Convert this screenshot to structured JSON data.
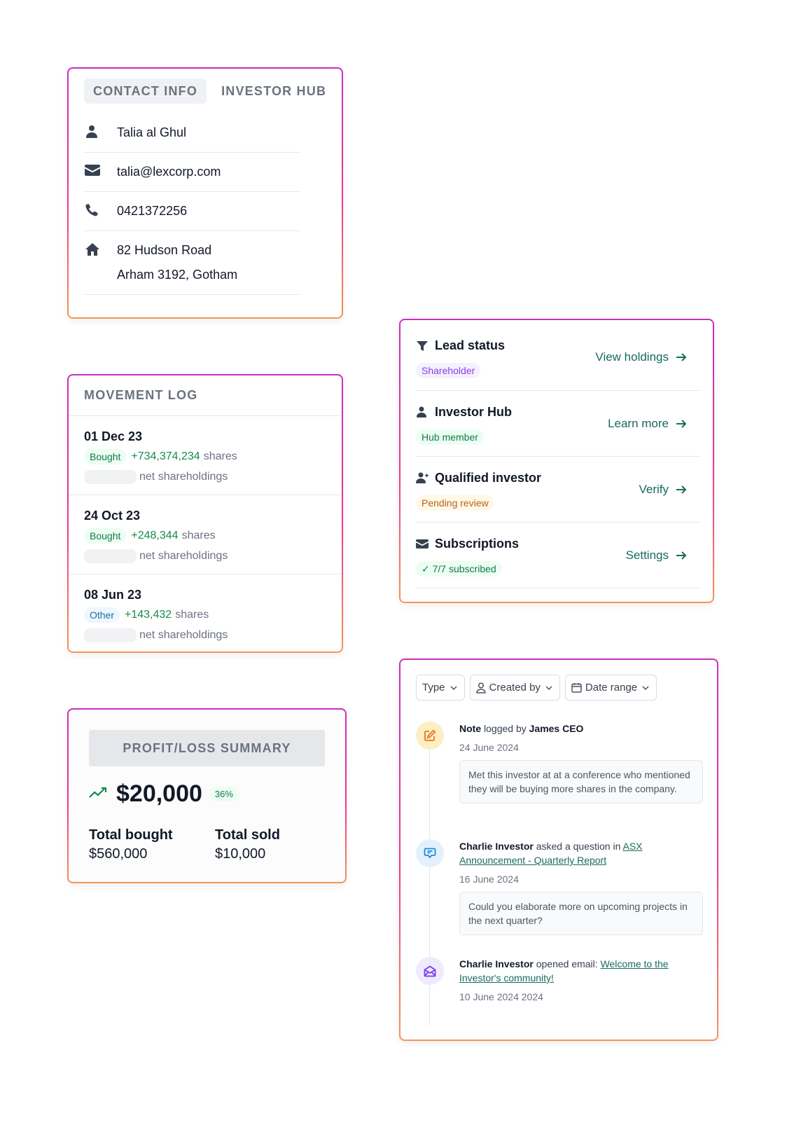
{
  "contact": {
    "tabs": [
      {
        "label": "CONTACT INFO",
        "active": true
      },
      {
        "label": "INVESTOR HUB",
        "active": false
      }
    ],
    "name": "Talia al Ghul",
    "email": "talia@lexcorp.com",
    "phone": "0421372256",
    "address_line1": "82 Hudson Road",
    "address_line2": "Arham 3192, Gotham",
    "icons": [
      "user-icon",
      "mail-icon",
      "phone-icon",
      "home-icon"
    ]
  },
  "movement_log": {
    "title": "MOVEMENT LOG",
    "items": [
      {
        "date": "01 Dec 23",
        "type": "Bought",
        "type_color": "green",
        "amount": "+734,374,234",
        "unit": "shares",
        "net_label": "net shareholdings"
      },
      {
        "date": "24 Oct 23",
        "type": "Bought",
        "type_color": "green",
        "amount": "+248,344",
        "unit": "shares",
        "net_label": "net shareholdings"
      },
      {
        "date": "08 Jun 23",
        "type": "Other",
        "type_color": "blue",
        "amount": "+143,432",
        "unit": "shares",
        "net_label": "net shareholdings"
      }
    ]
  },
  "profit_loss": {
    "title": "PROFIT/LOSS SUMMARY",
    "trend_icon": "trending-up-icon",
    "value": "$20,000",
    "percent": "36%",
    "total_bought_label": "Total bought",
    "total_bought_value": "$560,000",
    "total_sold_label": "Total sold",
    "total_sold_value": "$10,000"
  },
  "status": {
    "rows": [
      {
        "icon": "funnel-icon",
        "title": "Lead status",
        "badge": "Shareholder",
        "badge_color": "purple",
        "link": "View holdings"
      },
      {
        "icon": "user-icon",
        "title": "Investor Hub",
        "badge": "Hub member",
        "badge_color": "mint",
        "link": "Learn more"
      },
      {
        "icon": "user-plus-icon",
        "title": "Qualified investor",
        "badge": "Pending review",
        "badge_color": "amber",
        "link": "Verify"
      },
      {
        "icon": "mail-icon",
        "title": "Subscriptions",
        "badge": "✓ 7/7 subscribed",
        "badge_color": "mint",
        "link": "Settings"
      }
    ]
  },
  "activity": {
    "filters": [
      {
        "label": "Type",
        "icon": null
      },
      {
        "label": "Created by",
        "icon": "user-outline-icon"
      },
      {
        "label": "Date range",
        "icon": "calendar-icon"
      }
    ],
    "items": [
      {
        "icon": "pencil-square-icon",
        "actor": "Note",
        "action": " logged by ",
        "target_bold": "James CEO",
        "date": "24 June 2024",
        "body": "Met this investor at at a conference who mentioned they will be buying more shares in the company."
      },
      {
        "icon": "chat-bubble-icon",
        "actor": "Charlie Investor",
        "action": " asked a question in ",
        "link": "ASX Announcement - Quarterly Report",
        "date": "16 June 2024",
        "body": "Could you elaborate more on upcoming projects in the next quarter?"
      },
      {
        "icon": "envelope-open-icon",
        "actor": "Charlie Investor",
        "action": " opened email: ",
        "link": "Welcome to the Investor's community!",
        "date": "10 June 2024 2024"
      }
    ]
  },
  "colors": {
    "accent_link": "#176b5c",
    "positive": "#178a4f",
    "card_border_top": "#c92fc0",
    "card_border_bottom": "#f6955a"
  }
}
